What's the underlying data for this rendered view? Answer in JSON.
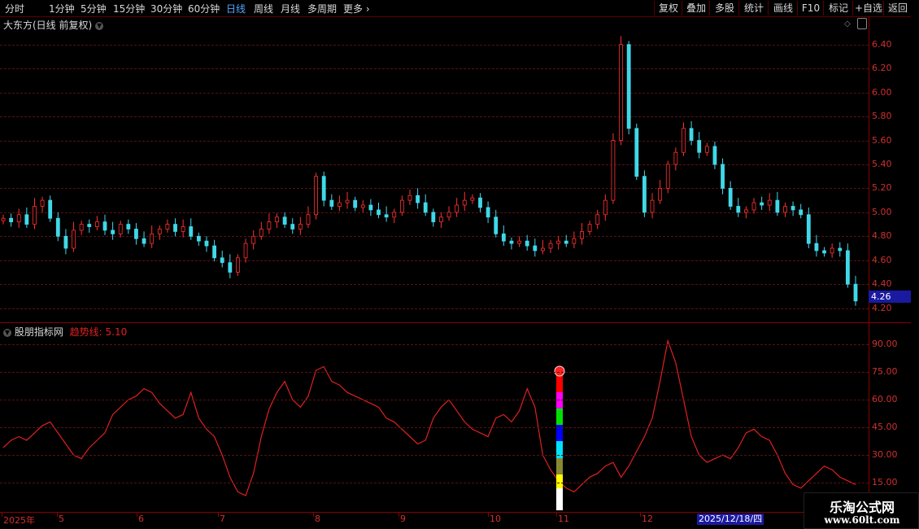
{
  "toolbar": {
    "tabs": [
      "分时",
      "1分钟",
      "5分钟",
      "15分钟",
      "30分钟",
      "60分钟",
      "日线",
      "周线",
      "月线",
      "多周期",
      "更多"
    ],
    "active_tab": "日线",
    "right_buttons": [
      "复权",
      "叠加",
      "多股",
      "统计",
      "画线",
      "F10",
      "标记",
      "+自选",
      "返回"
    ]
  },
  "main_chart": {
    "title": "大东方(日线 前复权)",
    "y_ticks": [
      "6.40",
      "6.20",
      "6.00",
      "5.80",
      "5.60",
      "5.40",
      "5.20",
      "5.00",
      "4.80",
      "4.60",
      "4.40",
      "4.20"
    ],
    "last_price": "4.26"
  },
  "indicator": {
    "name": "股朋指标网",
    "line_label": "趋势线: 5.10",
    "y_ticks": [
      "90.00",
      "75.00",
      "60.00",
      "45.00",
      "30.00",
      "15.00"
    ]
  },
  "x_axis": {
    "labels": [
      "2025年",
      "5",
      "6",
      "7",
      "8",
      "9",
      "10",
      "11",
      "12"
    ],
    "cursor_date": "2025/12/18/四"
  },
  "watermark": {
    "line1": "乐淘公式网",
    "line2": "www.60lt.com"
  },
  "colors": {
    "up": "#ff3030",
    "down": "#40d8e8",
    "grid": "#5a1010",
    "indicator_line": "#e02020"
  },
  "chart_data": [
    {
      "type": "candlestick",
      "title": "大东方(日线 前复权)",
      "ylim": [
        4.15,
        6.5
      ],
      "close_series_approx": [
        4.95,
        4.92,
        4.98,
        4.9,
        5.05,
        5.1,
        4.95,
        4.8,
        4.7,
        4.85,
        4.9,
        4.88,
        4.92,
        4.85,
        4.82,
        4.9,
        4.86,
        4.78,
        4.74,
        4.82,
        4.86,
        4.9,
        4.84,
        4.88,
        4.8,
        4.76,
        4.72,
        4.62,
        4.58,
        4.5,
        4.62,
        4.74,
        4.8,
        4.86,
        4.92,
        4.96,
        4.9,
        4.86,
        4.9,
        4.98,
        5.3,
        5.1,
        5.05,
        5.08,
        5.1,
        5.04,
        5.06,
        5.02,
        4.98,
        4.96,
        5.0,
        5.1,
        5.14,
        5.08,
        5.0,
        4.92,
        4.96,
        5.0,
        5.06,
        5.1,
        5.12,
        5.04,
        4.96,
        4.82,
        4.76,
        4.74,
        4.76,
        4.72,
        4.68,
        4.7,
        4.74,
        4.76,
        4.74,
        4.78,
        4.84,
        4.9,
        4.98,
        5.1,
        5.6,
        6.4,
        5.7,
        5.3,
        5.0,
        5.1,
        5.2,
        5.4,
        5.5,
        5.7,
        5.6,
        5.5,
        5.55,
        5.4,
        5.2,
        5.05,
        5.0,
        5.02,
        5.08,
        5.06,
        5.1,
        5.0,
        5.05,
        5.02,
        4.98,
        4.74,
        4.68,
        4.66,
        4.7,
        4.68,
        4.4,
        4.26
      ]
    },
    {
      "type": "line",
      "name": "趋势线",
      "ylim": [
        0,
        95
      ],
      "values": [
        34,
        38,
        40,
        38,
        42,
        46,
        48,
        42,
        36,
        30,
        28,
        34,
        38,
        42,
        52,
        56,
        60,
        62,
        66,
        64,
        58,
        54,
        50,
        52,
        64,
        50,
        44,
        40,
        30,
        18,
        10,
        8,
        20,
        40,
        55,
        64,
        70,
        60,
        56,
        62,
        76,
        78,
        70,
        68,
        64,
        62,
        60,
        58,
        56,
        50,
        48,
        44,
        40,
        36,
        38,
        50,
        56,
        60,
        54,
        48,
        44,
        42,
        40,
        50,
        52,
        48,
        54,
        66,
        56,
        30,
        22,
        16,
        12,
        10,
        14,
        18,
        20,
        24,
        26,
        18,
        24,
        32,
        40,
        50,
        70,
        92,
        80,
        60,
        40,
        30,
        26,
        28,
        30,
        28,
        34,
        42,
        44,
        40,
        38,
        30,
        20,
        14,
        12,
        16,
        20,
        24,
        22,
        18,
        16,
        14
      ]
    }
  ]
}
